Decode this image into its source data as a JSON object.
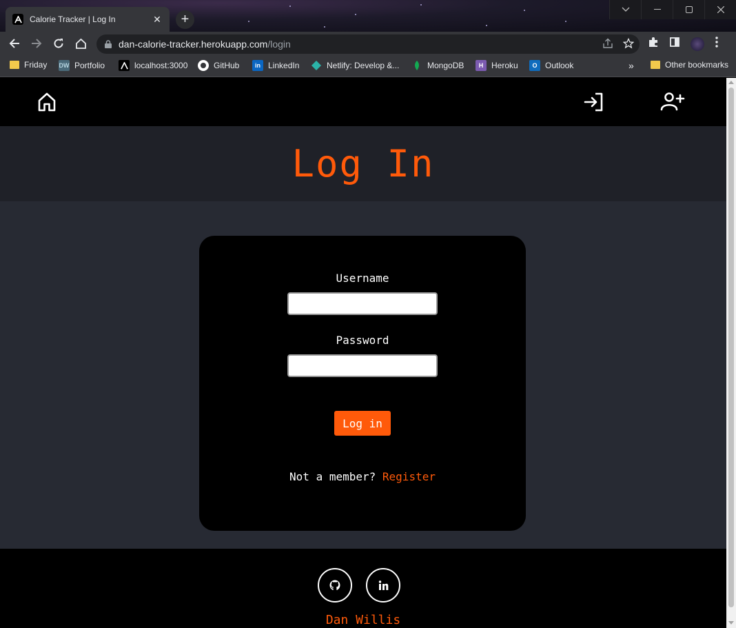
{
  "browser": {
    "tab_title": "Calorie Tracker | Log In",
    "url_host": "dan-calorie-tracker.herokuapp.com",
    "url_path": "/login",
    "bookmarks": [
      {
        "label": "Friday",
        "icon": "folder-icon"
      },
      {
        "label": "Portfolio",
        "icon": "dw-icon"
      },
      {
        "label": "localhost:3000",
        "icon": "app-icon"
      },
      {
        "label": "GitHub",
        "icon": "github-icon"
      },
      {
        "label": "LinkedIn",
        "icon": "linkedin-icon"
      },
      {
        "label": "Netlify: Develop &...",
        "icon": "netlify-icon"
      },
      {
        "label": "MongoDB",
        "icon": "mongodb-icon"
      },
      {
        "label": "Heroku",
        "icon": "heroku-icon"
      },
      {
        "label": "Outlook",
        "icon": "outlook-icon"
      }
    ],
    "other_bookmarks": "Other bookmarks",
    "overflow": "»"
  },
  "page": {
    "title": "Log In",
    "username_label": "Username",
    "username_value": "",
    "password_label": "Password",
    "password_value": "",
    "submit_label": "Log in",
    "member_text": "Not a member?",
    "register_link": "Register",
    "footer_author": "Dan Willis"
  },
  "colors": {
    "accent": "#ff5a0a",
    "nav_bg": "#000000",
    "page_bg": "#272a33",
    "hero_bg": "#1f2128"
  }
}
